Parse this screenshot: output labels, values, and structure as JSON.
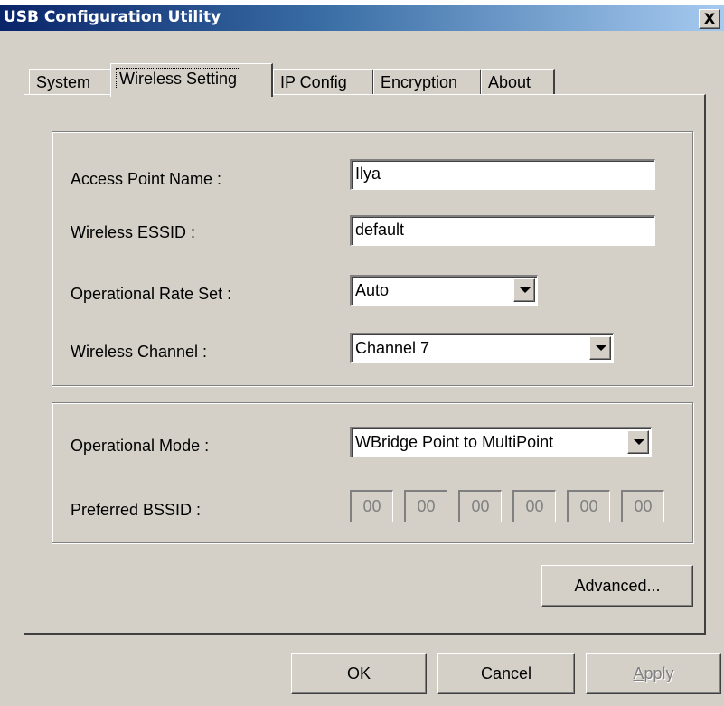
{
  "window": {
    "title": "USB Configuration Utility",
    "close_glyph": "X"
  },
  "tabs": [
    {
      "label": "System",
      "active": false
    },
    {
      "label": "Wireless Setting",
      "active": true
    },
    {
      "label": "IP Config",
      "active": false
    },
    {
      "label": "Encryption",
      "active": false
    },
    {
      "label": "About",
      "active": false
    }
  ],
  "wireless_group": {
    "access_point_name": {
      "label": "Access Point Name :",
      "value": "Ilya"
    },
    "essid": {
      "label": "Wireless ESSID :",
      "value": "default"
    },
    "rate_set": {
      "label": "Operational Rate Set :",
      "value": "Auto"
    },
    "channel": {
      "label": "Wireless Channel :",
      "value": "Channel 7"
    }
  },
  "mode_group": {
    "operational_mode": {
      "label": "Operational Mode :",
      "value": "WBridge Point to MultiPoint"
    },
    "preferred_bssid": {
      "label": "Preferred BSSID :",
      "octets": [
        "00",
        "00",
        "00",
        "00",
        "00",
        "00"
      ],
      "enabled": false
    }
  },
  "buttons": {
    "advanced": "Advanced...",
    "ok": "OK",
    "cancel": "Cancel",
    "apply_first": "A",
    "apply_rest": "pply"
  },
  "colors": {
    "face": "#d4d0c8",
    "titlebar_start": "#0a246a",
    "titlebar_end": "#a6caf0"
  }
}
